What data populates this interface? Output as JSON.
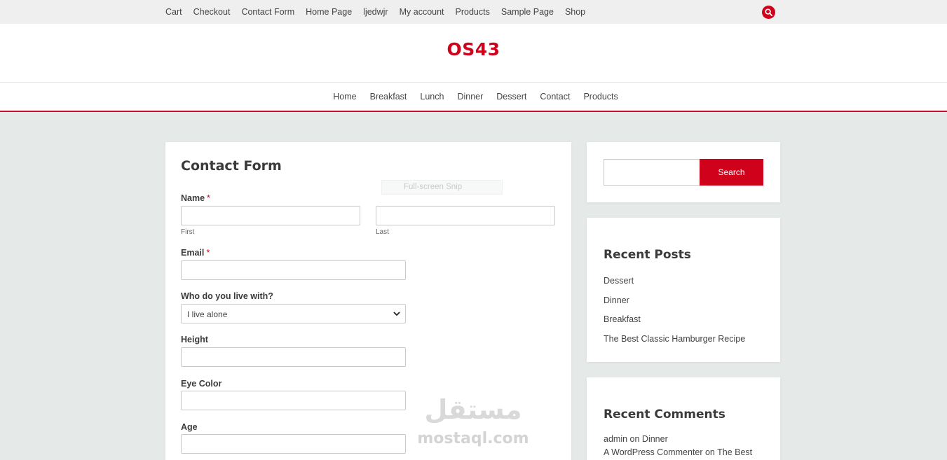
{
  "topbar": {
    "links": [
      "Cart",
      "Checkout",
      "Contact Form",
      "Home Page",
      "ljedwjr",
      "My account",
      "Products",
      "Sample Page",
      "Shop"
    ],
    "search_icon": "search-icon"
  },
  "site": {
    "title": "OS43"
  },
  "mainnav": {
    "links": [
      "Home",
      "Breakfast",
      "Lunch",
      "Dinner",
      "Dessert",
      "Contact",
      "Products"
    ]
  },
  "form": {
    "title": "Contact Form",
    "name_label": "Name",
    "required_mark": "*",
    "first_sub": "First",
    "last_sub": "Last",
    "email_label": "Email",
    "livewith_label": "Who do you live with?",
    "livewith_value": "I live alone",
    "height_label": "Height",
    "eye_label": "Eye Color",
    "age_label": "Age"
  },
  "overlay": {
    "snip": "Full-screen Snip"
  },
  "sidebar": {
    "search_button": "Search",
    "recent_posts_title": "Recent Posts",
    "recent_posts": [
      "Dessert",
      "Dinner",
      "Breakfast",
      "The Best Classic Hamburger Recipe"
    ],
    "recent_comments_title": "Recent Comments",
    "comments": [
      {
        "author": "admin",
        "on": "on",
        "post": "Dinner"
      },
      {
        "author": "A WordPress Commenter",
        "on": "on",
        "post": "The Best"
      }
    ]
  },
  "watermark": {
    "arabic": "مستقل",
    "latin": "mostaql.com"
  },
  "colors": {
    "accent": "#d0021b",
    "page_bg": "#e5e9e8",
    "topbar_bg": "#efefef"
  }
}
